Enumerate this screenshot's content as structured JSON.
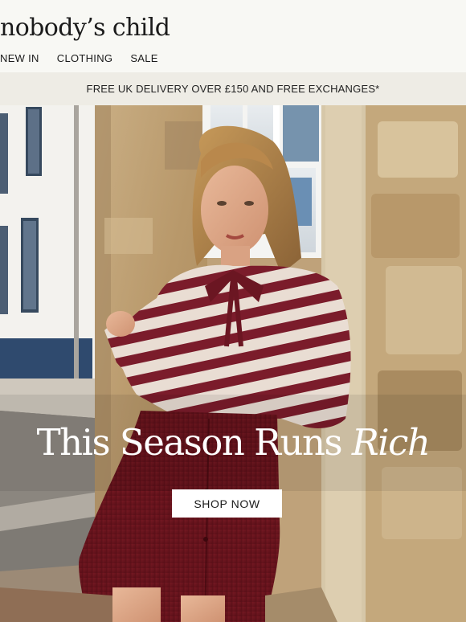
{
  "brand": {
    "logo_text": "nobody’s child"
  },
  "nav": {
    "items": [
      {
        "label": "NEW IN"
      },
      {
        "label": "CLOTHING"
      },
      {
        "label": "SALE"
      }
    ]
  },
  "announcement": {
    "text": "FREE UK DELIVERY OVER £150 AND FREE EXCHANGES*"
  },
  "hero": {
    "headline_regular": "This Season Runs",
    "headline_italic": "Rich",
    "cta_label": "SHOP NOW",
    "image_description": "model in burgundy striped knit jumper and burgundy corduroy skirt leaning against a stone wall"
  }
}
